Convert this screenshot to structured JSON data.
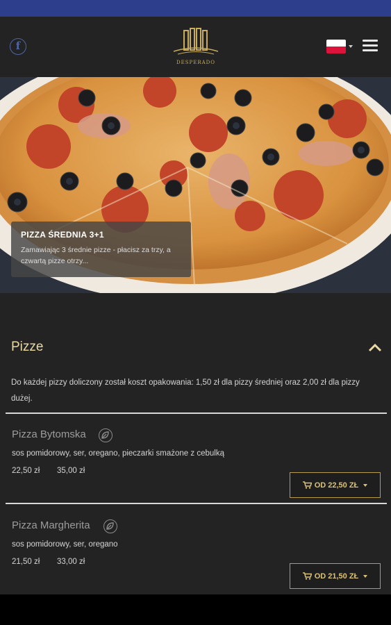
{
  "header": {
    "facebook_icon": "facebook-icon",
    "logo_text": "DESPERADO",
    "language_flag": "poland-flag",
    "menu_icon": "hamburger-menu-icon"
  },
  "hero": {
    "title": "PIZZA ŚREDNIA 3+1",
    "description": "Zamawiając 3 średnie pizze - płacisz za trzy, a czwartą pizze otrzy..."
  },
  "section": {
    "title": "Pizze",
    "note": "Do każdej pizzy doliczony został koszt opakowania: 1,50 zł dla pizzy średniej oraz 2,00 zł dla pizzy dużej.",
    "items": [
      {
        "name": "Pizza Bytomska",
        "description": "sos pomidorowy, ser, oregano, pieczarki smażone z cebulką",
        "price_medium": "22,50 zł",
        "price_large": "35,00 zł",
        "order_label": "OD 22,50 ZŁ"
      },
      {
        "name": "Pizza Margherita",
        "description": "sos pomidorowy, ser, oregano",
        "price_medium": "21,50 zł",
        "price_large": "33,00 zł",
        "order_label": "OD 21,50 ZŁ"
      }
    ]
  },
  "colors": {
    "statusbar": "#2d3e8c",
    "background": "#232323",
    "accent_gold": "#d9c278"
  }
}
